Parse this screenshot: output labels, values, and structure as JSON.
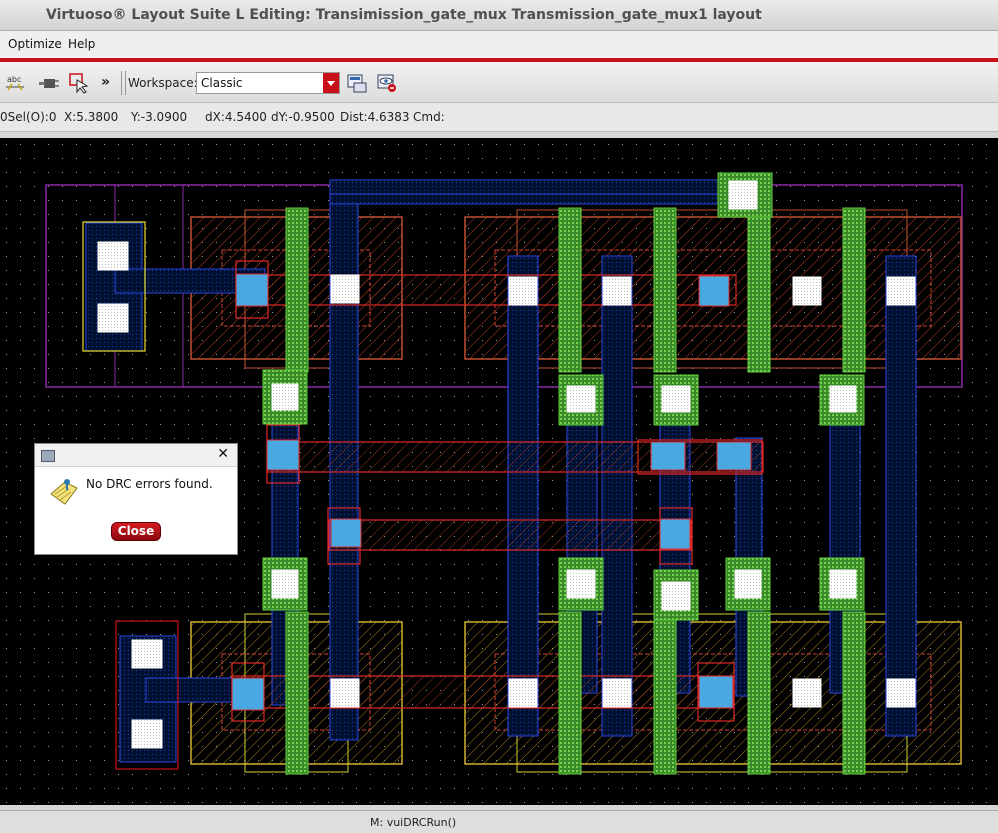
{
  "window": {
    "title": "Virtuoso® Layout Suite L Editing: Transimission_gate_mux Transmission_gate_mux1 layout"
  },
  "menu": {
    "items": [
      "Optimize",
      "Help"
    ]
  },
  "toolbar": {
    "more_label": "»",
    "workspace_label": "Workspace:",
    "workspace_value": "Classic",
    "icons": [
      "text-tool-icon",
      "plug-icon",
      "select-cursor-icon",
      "workspace-save-icon",
      "workspace-visibility-icon"
    ]
  },
  "status": {
    "sel": "0Sel(O):0",
    "x": "X:5.3800",
    "y": "Y:-3.0900",
    "dx": "dX:4.5400",
    "dy": "dY:-0.9500",
    "dist": "Dist:4.6383",
    "cmd": "Cmd:"
  },
  "dialog": {
    "message": "No DRC errors found.",
    "close_label": "Close"
  },
  "bottom": {
    "mouse_text": "M: vuiDRCRun()"
  },
  "colors": {
    "accent": "#c8101a",
    "canvas": "#000000"
  }
}
